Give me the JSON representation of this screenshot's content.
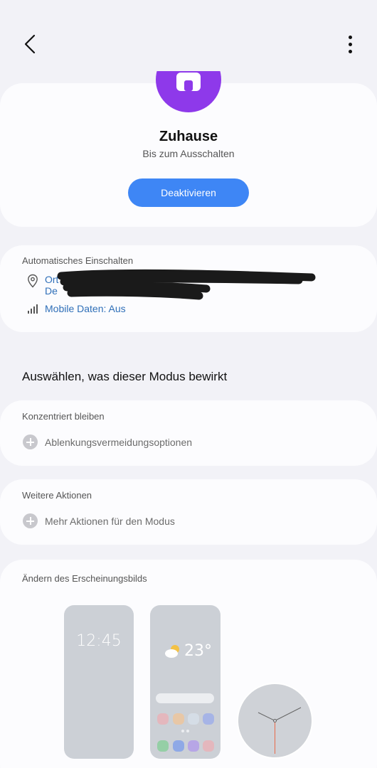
{
  "mode": {
    "title": "Zuhause",
    "subtitle": "Bis zum Ausschalten",
    "deactivate_label": "Deaktivieren",
    "icon": "home-icon",
    "icon_color": "#8e39ea"
  },
  "auto": {
    "label": "Automatisches Einschalten",
    "location_line1": "Ort",
    "location_line2": "De",
    "mobile_data": "Mobile Daten: Aus"
  },
  "section_heading": "Auswählen, was dieser Modus bewirkt",
  "focus": {
    "label": "Konzentriert bleiben",
    "option": "Ablenkungsvermeidungsoptionen"
  },
  "more": {
    "label": "Weitere Aktionen",
    "option": "Mehr Aktionen für den Modus"
  },
  "appearance": {
    "label": "Ändern des Erscheinungsbilds",
    "lockscreen_time": "12:45",
    "home_temperature": "23°"
  },
  "colors": {
    "accent": "#3e86f5",
    "link": "#2f6fb8",
    "mode_purple": "#8e39ea"
  }
}
